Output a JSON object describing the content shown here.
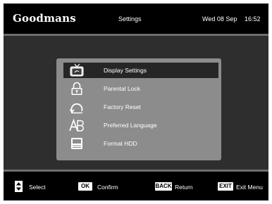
{
  "header": {
    "brand": "Goodmans",
    "title": "Settings",
    "date": "Wed 08 Sep",
    "time": "16:52"
  },
  "menu": {
    "selected_index": 0,
    "items": [
      {
        "label": "Display Settings",
        "icon": "tv-icon"
      },
      {
        "label": "Parental Lock",
        "icon": "padlock-icon"
      },
      {
        "label": "Factory Reset",
        "icon": "reset-icon"
      },
      {
        "label": "Preferred Language",
        "icon": "language-icon"
      },
      {
        "label": "Format HDD",
        "icon": "hard-drive-icon"
      }
    ]
  },
  "footer": {
    "select_icon": "up-down-arrows-icon",
    "select_label": "Select",
    "ok_key": "OK",
    "confirm_label": "Confirm",
    "back_key": "BACK",
    "return_label": "Return",
    "exit_key": "EXIT",
    "exit_label": "Exit Menu"
  },
  "colors": {
    "background": "#000000",
    "body": "#2e2e2e",
    "panel": "#8c8c8c",
    "highlight": "#262626",
    "divider": "#6e6e6e",
    "text": "#ffffff"
  }
}
